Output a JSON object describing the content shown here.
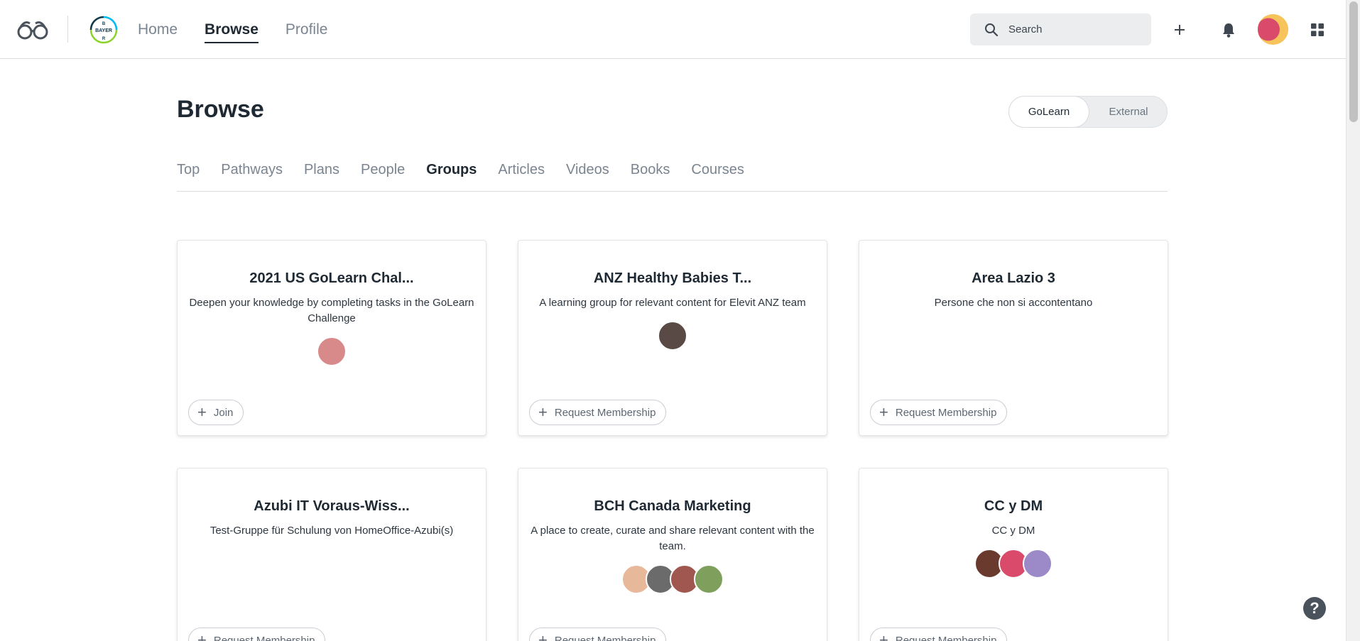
{
  "nav": {
    "items": [
      "Home",
      "Browse",
      "Profile"
    ],
    "active": "Browse"
  },
  "search": {
    "placeholder": "Search"
  },
  "header": {
    "title": "Browse"
  },
  "source_toggle": {
    "options": [
      "GoLearn",
      "External"
    ],
    "selected": "GoLearn"
  },
  "tabs": {
    "items": [
      "Top",
      "Pathways",
      "Plans",
      "People",
      "Groups",
      "Articles",
      "Videos",
      "Books",
      "Courses"
    ],
    "active": "Groups"
  },
  "brand": {
    "logo_text": "BAYER",
    "accent": "#1f2933",
    "card_border": "#e2e4e8"
  },
  "groups": [
    {
      "title": "2021 US GoLearn Chal...",
      "description": "Deepen your knowledge by completing tasks in the GoLearn Challenge",
      "action": "Join",
      "member_colors": [
        "#d88a8a"
      ]
    },
    {
      "title": "ANZ Healthy Babies T...",
      "description": "A learning group for relevant content for Elevit ANZ team",
      "action": "Request Membership",
      "member_colors": [
        "#5a4a45"
      ]
    },
    {
      "title": "Area Lazio 3",
      "description": "Persone che non si accontentano",
      "action": "Request Membership",
      "member_colors": []
    },
    {
      "title": "Azubi IT Voraus-Wiss...",
      "description": "Test-Gruppe für Schulung von HomeOffice-Azubi(s)",
      "action": "Request Membership",
      "member_colors": []
    },
    {
      "title": "BCH Canada Marketing",
      "description": "A place to create, curate and share relevant content with the team.",
      "action": "Request Membership",
      "member_colors": [
        "#e8b89a",
        "#6b6b6b",
        "#a0574f",
        "#7ea05c"
      ]
    },
    {
      "title": "CC y DM",
      "description": "CC y DM",
      "action": "Request Membership",
      "member_colors": [
        "#6b3a2e",
        "#d94a6b",
        "#9c8ac8"
      ]
    }
  ],
  "help": {
    "label": "?"
  }
}
